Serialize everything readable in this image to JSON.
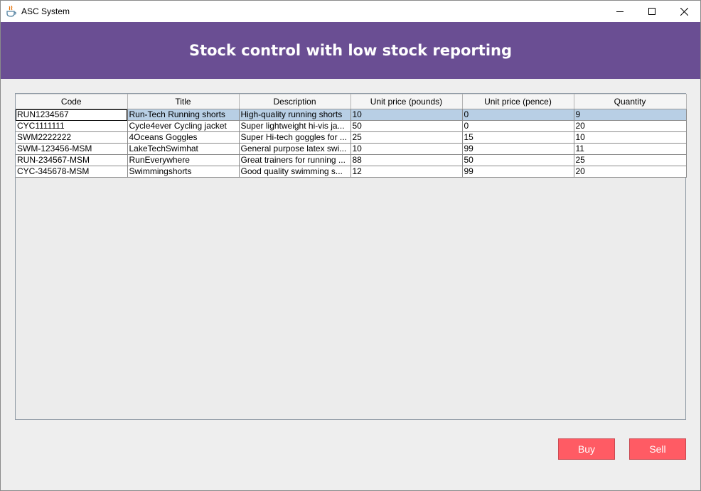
{
  "window": {
    "title": "ASC System",
    "icon": "java-cup-icon",
    "controls": [
      "minimize-icon",
      "maximize-icon",
      "close-icon"
    ]
  },
  "header": {
    "title": "Stock control with low stock reporting",
    "background": "#6a4e93"
  },
  "table": {
    "columns": [
      "Code",
      "Title",
      "Description",
      "Unit price (pounds)",
      "Unit price (pence)",
      "Quantity"
    ],
    "selected_row": 0,
    "rows": [
      [
        "RUN1234567",
        "Run-Tech Running shorts",
        "High-quality running shorts",
        "10",
        "0",
        "9"
      ],
      [
        "CYC1111111",
        "Cycle4ever Cycling jacket",
        "Super lightweight hi-vis ja...",
        "50",
        "0",
        "20"
      ],
      [
        "SWM2222222",
        "4Oceans Goggles",
        "Super Hi-tech goggles for ...",
        "25",
        "15",
        "10"
      ],
      [
        "SWM-123456-MSM",
        "LakeTechSwimhat",
        "General purpose latex swi...",
        "10",
        "99",
        "11"
      ],
      [
        "RUN-234567-MSM",
        "RunEverywhere",
        "Great trainers for running ...",
        "88",
        "50",
        "25"
      ],
      [
        "CYC-345678-MSM",
        "Swimmingshorts",
        "Good quality swimming s...",
        "12",
        "99",
        "20"
      ]
    ]
  },
  "actions": {
    "buy_label": "Buy",
    "sell_label": "Sell",
    "button_color": "#ff5b64"
  }
}
